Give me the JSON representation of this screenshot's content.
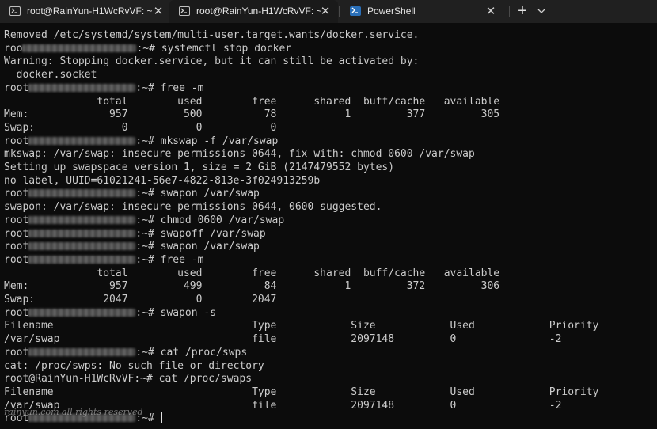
{
  "tabs": [
    {
      "title": "root@RainYun-H1WcRvVF: ~",
      "icon": "terminal-icon",
      "active": false
    },
    {
      "title": "root@RainYun-H1WcRvVF: ~",
      "icon": "terminal-icon",
      "active": true
    },
    {
      "title": "PowerShell",
      "icon": "powershell-icon",
      "active": false
    }
  ],
  "tab_close_glyph": "✕",
  "new_tab_glyph": "+",
  "terminal": {
    "prompt_user": "root@RainYun-H1WcRvVF:~# ",
    "lines": [
      {
        "text": "Removed /etc/systemd/system/multi-user.target.wants/docker.service."
      },
      {
        "pre": "roo",
        "blur": true,
        "post": ":~# systemctl stop docker"
      },
      {
        "text": "Warning: Stopping docker.service, but it can still be activated by:"
      },
      {
        "text": "  docker.socket"
      },
      {
        "pre": "root",
        "blur": true,
        "post": ":~# free -m"
      },
      {
        "text": "               total        used        free      shared  buff/cache   available"
      },
      {
        "text": "Mem:             957         500          78           1         377         305"
      },
      {
        "text": "Swap:              0           0           0"
      },
      {
        "pre": "root",
        "blur": true,
        "post": ":~# mkswap -f /var/swap"
      },
      {
        "text": "mkswap: /var/swap: insecure permissions 0644, fix with: chmod 0600 /var/swap"
      },
      {
        "text": "Setting up swapspace version 1, size = 2 GiB (2147479552 bytes)"
      },
      {
        "text": "no label, UUID=61021241-56e7-4822-813e-3f024913259b"
      },
      {
        "pre": "root",
        "blur": true,
        "post": ":~# swapon /var/swap"
      },
      {
        "text": "swapon: /var/swap: insecure permissions 0644, 0600 suggested."
      },
      {
        "pre": "root",
        "blur": true,
        "post": ":~# chmod 0600 /var/swap"
      },
      {
        "pre": "root",
        "blur": true,
        "post": ":~# swapoff /var/swap"
      },
      {
        "pre": "root",
        "blur": true,
        "post": ":~# swapon /var/swap"
      },
      {
        "pre": "root",
        "blur": true,
        "post": ":~# free -m"
      },
      {
        "text": "               total        used        free      shared  buff/cache   available"
      },
      {
        "text": "Mem:             957         499          84           1         372         306"
      },
      {
        "text": "Swap:           2047           0        2047"
      },
      {
        "pre": "root",
        "blur": true,
        "post": ":~# swapon -s"
      },
      {
        "text": "Filename                                Type            Size            Used            Priority"
      },
      {
        "text": "/var/swap                               file            2097148         0               -2"
      },
      {
        "pre": "root",
        "blur": true,
        "post": ":~# cat /proc/swps"
      },
      {
        "text": "cat: /proc/swps: No such file or directory"
      },
      {
        "text": "root@RainYun-H1WcRvVF:~# cat /proc/swaps"
      },
      {
        "text": "Filename                                Type            Size            Used            Priority"
      },
      {
        "text": "/var/swap                               file            2097148         0               -2"
      },
      {
        "pre": "root",
        "blur": true,
        "post": ":~# "
      }
    ],
    "watermark": "rainyun.com all rights reserved"
  },
  "colors": {
    "background": "#0c0c0c",
    "text": "#cccccc",
    "tabbar": "#202020",
    "active_tab": "#1a1a1a"
  }
}
